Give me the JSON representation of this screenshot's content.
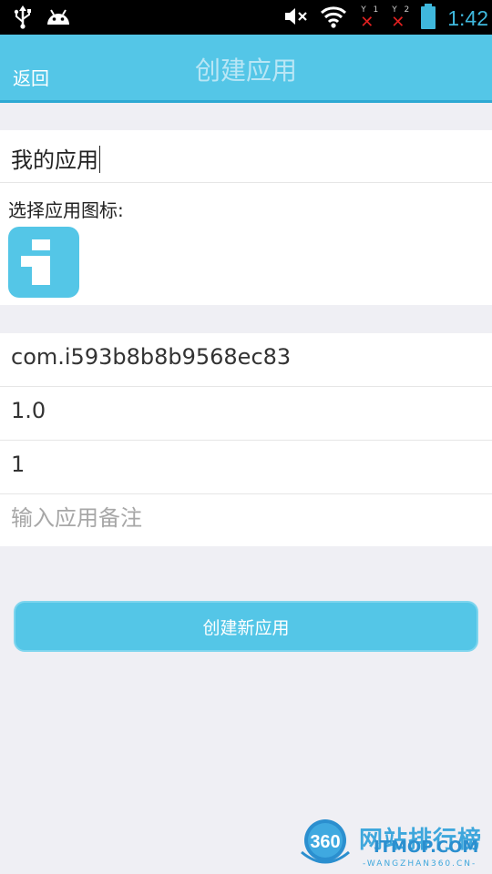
{
  "status_bar": {
    "time": "1:42",
    "sim1_number": "1",
    "sim2_number": "2",
    "icons": [
      "usb-icon",
      "android-icon",
      "mute-icon",
      "wifi-icon",
      "signal-icon",
      "signal-icon",
      "battery-icon"
    ]
  },
  "header": {
    "back_label": "返回",
    "title": "创建应用"
  },
  "form": {
    "app_name": "我的应用",
    "icon_label": "选择应用图标:",
    "package_name": "com.i593b8b8b9568ec83",
    "version_name": "1.0",
    "version_code": "1",
    "note_placeholder": "输入应用备注"
  },
  "actions": {
    "create_label": "创建新应用"
  },
  "watermark": {
    "badge": "360",
    "title": "网站排行榜",
    "domain": "ITMOP.COM",
    "subdomain": "-WANGZHAN360.CN-"
  },
  "colors": {
    "accent": "#54c6e7",
    "background": "#efeff4",
    "status_bar": "#000000",
    "error_x": "#e02020"
  }
}
